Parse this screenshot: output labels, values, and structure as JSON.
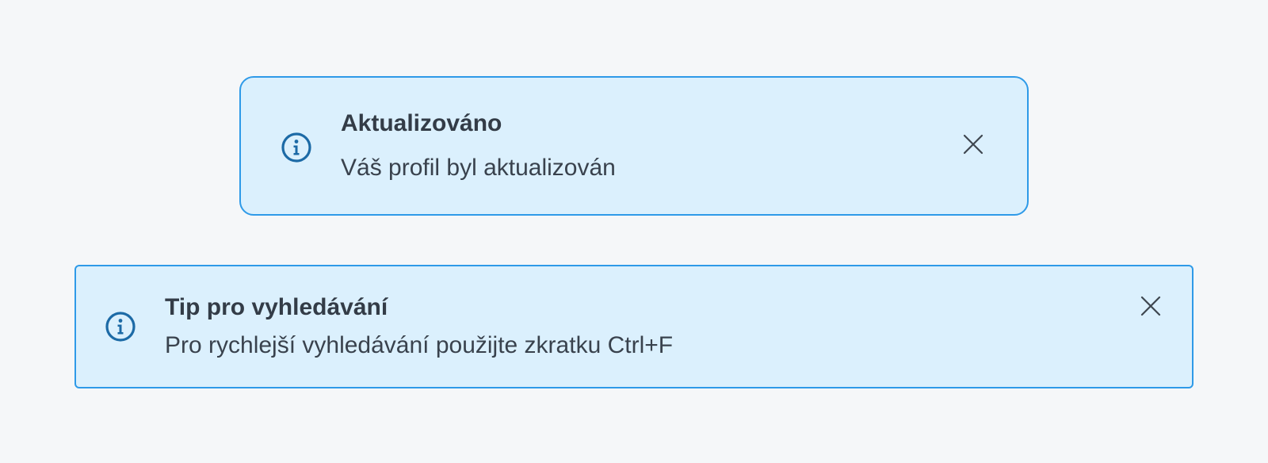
{
  "colors": {
    "page_background": "#f5f7f9",
    "alert_background": "#dbf0fd",
    "alert_border": "#2e9ae8",
    "icon": "#1c6aa6",
    "text": "#333c47"
  },
  "alerts": [
    {
      "icon": "info-circle-icon",
      "title": "Aktualizováno",
      "message": "Váš profil byl aktualizován",
      "close_icon": "close-icon"
    },
    {
      "icon": "info-circle-icon",
      "title": "Tip pro vyhledávání",
      "message": "Pro rychlejší vyhledávání použijte zkratku Ctrl+F",
      "close_icon": "close-icon"
    }
  ]
}
